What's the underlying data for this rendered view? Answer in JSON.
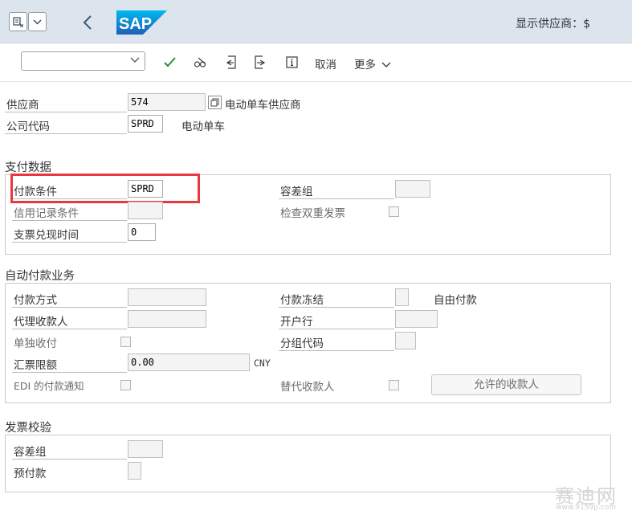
{
  "header": {
    "title": "显示供应商：$",
    "logo_text": "SAP"
  },
  "toolbar": {
    "cancel_label": "取消",
    "more_label": "更多",
    "command_value": ""
  },
  "vendor": {
    "vendor_label": "供应商",
    "vendor_value": "574",
    "vendor_name": "电动单车供应商",
    "company_code_label": "公司代码",
    "company_code_value": "SPRD",
    "company_name": "电动单车"
  },
  "payment_data": {
    "title": "支付数据",
    "payment_terms_label": "付款条件",
    "payment_terms_value": "SPRD",
    "tolerance_group_label": "容差组",
    "tolerance_group_value": "",
    "credit_memo_terms_label": "信用记录条件",
    "credit_memo_terms_value": "",
    "double_invoice_check_label": "检查双重发票",
    "check_cashing_time_label": "支票兑现时间",
    "check_cashing_time_value": "0"
  },
  "auto_payment": {
    "title": "自动付款业务",
    "payment_methods_label": "付款方式",
    "payment_block_label": "付款冻结",
    "payment_block_desc": "自由付款",
    "alt_payee_label": "代理收款人",
    "house_bank_label": "开户行",
    "individual_payment_label": "单独收付",
    "grouping_key_label": "分组代码",
    "bill_exchange_limit_label": "汇票限额",
    "bill_exchange_limit_value": "0.00",
    "currency": "CNY",
    "edi_label": "EDI 的付款通知",
    "alt_payee_doc_label": "替代收款人",
    "permitted_payee_button": "允许的收款人"
  },
  "invoice_verification": {
    "title": "发票校验",
    "tolerance_group_label": "容差组",
    "prepayment_label": "预付款"
  },
  "watermark": {
    "text": "赛迪网",
    "url": "www.9159p.com"
  }
}
